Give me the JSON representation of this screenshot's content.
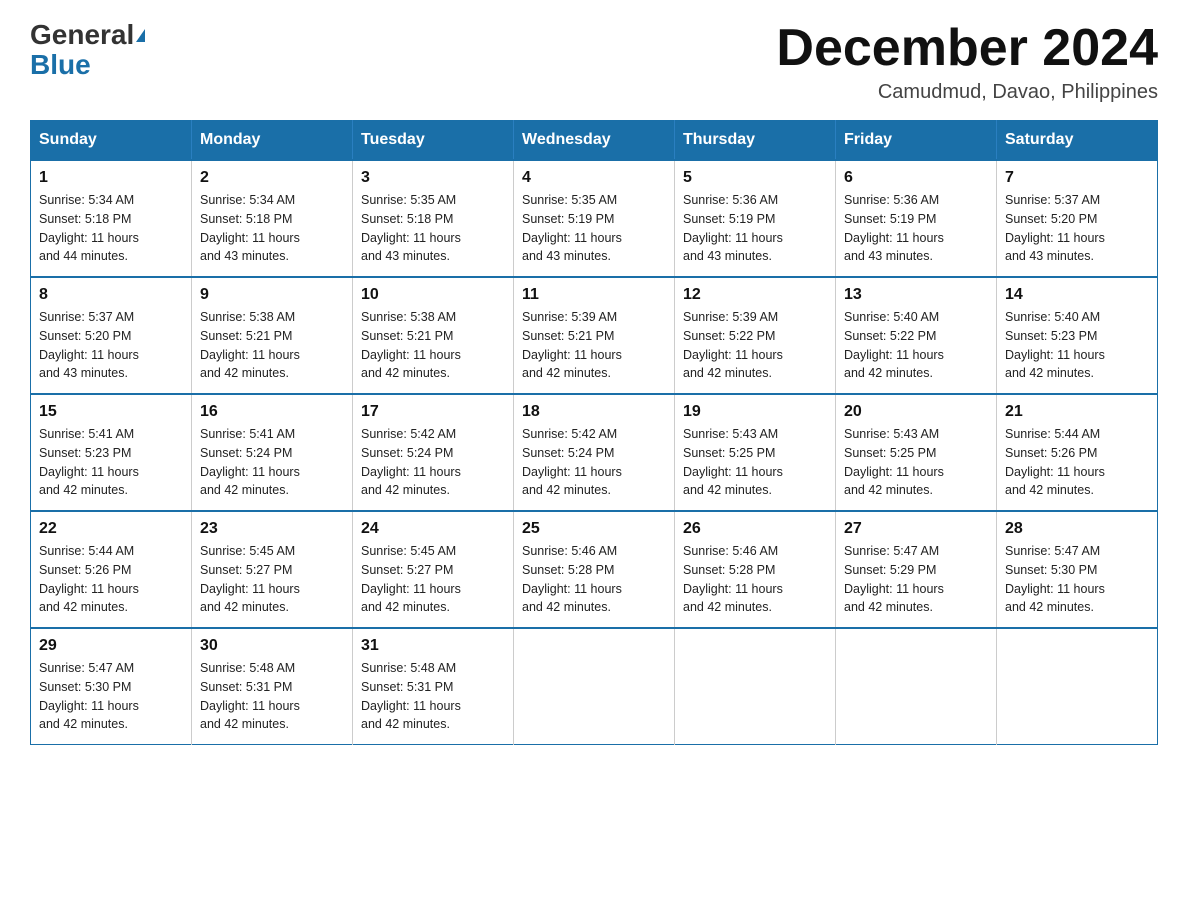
{
  "header": {
    "logo_general": "General",
    "logo_blue": "Blue",
    "month_title": "December 2024",
    "location": "Camudmud, Davao, Philippines"
  },
  "weekdays": [
    "Sunday",
    "Monday",
    "Tuesday",
    "Wednesday",
    "Thursday",
    "Friday",
    "Saturday"
  ],
  "weeks": [
    [
      {
        "day": "1",
        "sunrise": "5:34 AM",
        "sunset": "5:18 PM",
        "daylight": "11 hours and 44 minutes."
      },
      {
        "day": "2",
        "sunrise": "5:34 AM",
        "sunset": "5:18 PM",
        "daylight": "11 hours and 43 minutes."
      },
      {
        "day": "3",
        "sunrise": "5:35 AM",
        "sunset": "5:18 PM",
        "daylight": "11 hours and 43 minutes."
      },
      {
        "day": "4",
        "sunrise": "5:35 AM",
        "sunset": "5:19 PM",
        "daylight": "11 hours and 43 minutes."
      },
      {
        "day": "5",
        "sunrise": "5:36 AM",
        "sunset": "5:19 PM",
        "daylight": "11 hours and 43 minutes."
      },
      {
        "day": "6",
        "sunrise": "5:36 AM",
        "sunset": "5:19 PM",
        "daylight": "11 hours and 43 minutes."
      },
      {
        "day": "7",
        "sunrise": "5:37 AM",
        "sunset": "5:20 PM",
        "daylight": "11 hours and 43 minutes."
      }
    ],
    [
      {
        "day": "8",
        "sunrise": "5:37 AM",
        "sunset": "5:20 PM",
        "daylight": "11 hours and 43 minutes."
      },
      {
        "day": "9",
        "sunrise": "5:38 AM",
        "sunset": "5:21 PM",
        "daylight": "11 hours and 42 minutes."
      },
      {
        "day": "10",
        "sunrise": "5:38 AM",
        "sunset": "5:21 PM",
        "daylight": "11 hours and 42 minutes."
      },
      {
        "day": "11",
        "sunrise": "5:39 AM",
        "sunset": "5:21 PM",
        "daylight": "11 hours and 42 minutes."
      },
      {
        "day": "12",
        "sunrise": "5:39 AM",
        "sunset": "5:22 PM",
        "daylight": "11 hours and 42 minutes."
      },
      {
        "day": "13",
        "sunrise": "5:40 AM",
        "sunset": "5:22 PM",
        "daylight": "11 hours and 42 minutes."
      },
      {
        "day": "14",
        "sunrise": "5:40 AM",
        "sunset": "5:23 PM",
        "daylight": "11 hours and 42 minutes."
      }
    ],
    [
      {
        "day": "15",
        "sunrise": "5:41 AM",
        "sunset": "5:23 PM",
        "daylight": "11 hours and 42 minutes."
      },
      {
        "day": "16",
        "sunrise": "5:41 AM",
        "sunset": "5:24 PM",
        "daylight": "11 hours and 42 minutes."
      },
      {
        "day": "17",
        "sunrise": "5:42 AM",
        "sunset": "5:24 PM",
        "daylight": "11 hours and 42 minutes."
      },
      {
        "day": "18",
        "sunrise": "5:42 AM",
        "sunset": "5:24 PM",
        "daylight": "11 hours and 42 minutes."
      },
      {
        "day": "19",
        "sunrise": "5:43 AM",
        "sunset": "5:25 PM",
        "daylight": "11 hours and 42 minutes."
      },
      {
        "day": "20",
        "sunrise": "5:43 AM",
        "sunset": "5:25 PM",
        "daylight": "11 hours and 42 minutes."
      },
      {
        "day": "21",
        "sunrise": "5:44 AM",
        "sunset": "5:26 PM",
        "daylight": "11 hours and 42 minutes."
      }
    ],
    [
      {
        "day": "22",
        "sunrise": "5:44 AM",
        "sunset": "5:26 PM",
        "daylight": "11 hours and 42 minutes."
      },
      {
        "day": "23",
        "sunrise": "5:45 AM",
        "sunset": "5:27 PM",
        "daylight": "11 hours and 42 minutes."
      },
      {
        "day": "24",
        "sunrise": "5:45 AM",
        "sunset": "5:27 PM",
        "daylight": "11 hours and 42 minutes."
      },
      {
        "day": "25",
        "sunrise": "5:46 AM",
        "sunset": "5:28 PM",
        "daylight": "11 hours and 42 minutes."
      },
      {
        "day": "26",
        "sunrise": "5:46 AM",
        "sunset": "5:28 PM",
        "daylight": "11 hours and 42 minutes."
      },
      {
        "day": "27",
        "sunrise": "5:47 AM",
        "sunset": "5:29 PM",
        "daylight": "11 hours and 42 minutes."
      },
      {
        "day": "28",
        "sunrise": "5:47 AM",
        "sunset": "5:30 PM",
        "daylight": "11 hours and 42 minutes."
      }
    ],
    [
      {
        "day": "29",
        "sunrise": "5:47 AM",
        "sunset": "5:30 PM",
        "daylight": "11 hours and 42 minutes."
      },
      {
        "day": "30",
        "sunrise": "5:48 AM",
        "sunset": "5:31 PM",
        "daylight": "11 hours and 42 minutes."
      },
      {
        "day": "31",
        "sunrise": "5:48 AM",
        "sunset": "5:31 PM",
        "daylight": "11 hours and 42 minutes."
      },
      null,
      null,
      null,
      null
    ]
  ],
  "labels": {
    "sunrise": "Sunrise:",
    "sunset": "Sunset:",
    "daylight": "Daylight:"
  }
}
